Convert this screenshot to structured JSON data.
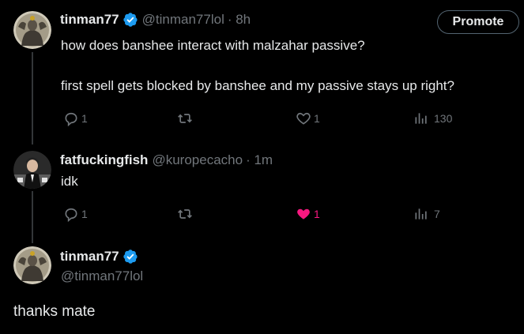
{
  "tweets": [
    {
      "name": "tinman77",
      "handle": "@tinman77lol",
      "time": "· 8h",
      "verified": true,
      "promote_label": "Promote",
      "lines": [
        "how does banshee interact with malzahar passive?",
        "first spell gets blocked by banshee and my passive stays up right?"
      ],
      "replies": "1",
      "likes": "1",
      "views": "130"
    },
    {
      "name": "fatfuckingfish",
      "handle": "@kuropecacho",
      "time": "· 1m",
      "text": "idk",
      "replies": "1",
      "likes": "1",
      "liked": true,
      "views": "7"
    },
    {
      "name": "tinman77",
      "handle": "@tinman77lol",
      "verified": true,
      "text": "thanks mate"
    }
  ],
  "colors": {
    "background": "#000000",
    "text": "#e7e9ea",
    "muted": "#71767b",
    "verified": "#1d9bf0",
    "like_active": "#f91880"
  },
  "icons": [
    "verified-badge-icon",
    "reply-icon",
    "retweet-icon",
    "like-icon",
    "views-icon"
  ]
}
